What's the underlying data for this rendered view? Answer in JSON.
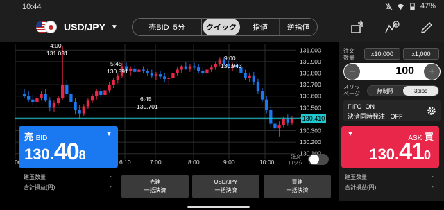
{
  "status_bar": {
    "time": "10:44",
    "battery": "47%"
  },
  "header": {
    "pair": "USD/JPY",
    "order_side": "売BID",
    "timeframe": "5分",
    "order_tabs": [
      "クイック",
      "指値",
      "逆指値"
    ],
    "active_tab": "クイック"
  },
  "chart": {
    "y_labels": [
      "131.000",
      "130.900",
      "130.800",
      "130.700",
      "130.600",
      "130.500",
      "130.400",
      "130.300",
      "130.200",
      "130.100"
    ],
    "x_labels": [
      "6:00",
      "6:10",
      "7:00",
      "8:00",
      "9:00",
      "10:00"
    ],
    "annotations": [
      {
        "time": "4:00",
        "price": "131.031"
      },
      {
        "time": "5:45",
        "price": "130.891"
      },
      {
        "time": "6:45",
        "price": "130.701"
      },
      {
        "time": "9:00",
        "price": "130.943"
      }
    ],
    "last_price": "130.410",
    "lock_label_1": "注文",
    "lock_label_2": "ロック"
  },
  "bid": {
    "side": "売",
    "label": "BID",
    "price_small": "130.",
    "price_large": "40",
    "price_tiny": "8"
  },
  "ask": {
    "side": "買",
    "label": "ASK",
    "price_small": "130.",
    "price_large": "41",
    "price_tiny": "0"
  },
  "panel": {
    "qty_label_1": "注文",
    "qty_label_2": "数量",
    "presets": [
      "x10,000",
      "x1,000"
    ],
    "quantity": "100",
    "slip_label_1": "スリッ",
    "slip_label_2": "ページ",
    "slip_options": [
      "無制限",
      "3pips"
    ],
    "fifo_label": "FIFO",
    "fifo_value": "ON",
    "simul_label": "決済同時発注",
    "simul_value": "OFF"
  },
  "bottom": {
    "left_stats": [
      {
        "label": "建玉数量",
        "value": "-"
      },
      {
        "label": "合計損益(円)",
        "value": "-"
      }
    ],
    "right_stats": [
      {
        "label": "建玉数量",
        "value": "-"
      },
      {
        "label": "合計損益(円)",
        "value": "-"
      }
    ],
    "buttons": [
      {
        "line1": "売建",
        "line2": "一括決済"
      },
      {
        "line1": "USD/JPY",
        "line2": "一括決済"
      },
      {
        "line1": "買建",
        "line2": "一括決済"
      }
    ]
  },
  "colors": {
    "up": "#e8274a",
    "down": "#1a78f0",
    "last": "#1fc7cf"
  },
  "chart_data": {
    "type": "candlestick",
    "ylim": [
      130.05,
      131.05
    ],
    "x_ticks": [
      "6:00",
      "6:10",
      "7:00",
      "8:00",
      "9:00",
      "10:00"
    ],
    "candles": [
      [
        130.62,
        130.66,
        130.58,
        130.6
      ],
      [
        130.6,
        130.64,
        130.55,
        130.57
      ],
      [
        130.57,
        130.61,
        130.52,
        130.55
      ],
      [
        130.55,
        130.6,
        130.5,
        130.58
      ],
      [
        130.58,
        130.64,
        130.56,
        130.62
      ],
      [
        130.62,
        130.66,
        130.55,
        130.56
      ],
      [
        130.56,
        130.59,
        130.47,
        130.5
      ],
      [
        130.5,
        130.56,
        130.46,
        130.54
      ],
      [
        130.54,
        130.6,
        130.52,
        130.58
      ],
      [
        130.58,
        131.03,
        130.57,
        130.7
      ],
      [
        130.7,
        130.74,
        130.6,
        130.62
      ],
      [
        130.62,
        130.65,
        130.52,
        130.55
      ],
      [
        130.55,
        130.58,
        130.44,
        130.48
      ],
      [
        130.48,
        130.52,
        130.4,
        130.45
      ],
      [
        130.45,
        130.53,
        130.43,
        130.51
      ],
      [
        130.51,
        130.58,
        130.49,
        130.56
      ],
      [
        130.56,
        130.62,
        130.54,
        130.6
      ],
      [
        130.6,
        130.66,
        130.57,
        130.64
      ],
      [
        130.64,
        130.67,
        130.59,
        130.61
      ],
      [
        130.61,
        130.66,
        130.58,
        130.65
      ],
      [
        130.65,
        130.72,
        130.63,
        130.7
      ],
      [
        130.7,
        130.76,
        130.67,
        130.74
      ],
      [
        130.74,
        130.8,
        130.71,
        130.78
      ],
      [
        130.78,
        130.89,
        130.76,
        130.86
      ],
      [
        130.86,
        130.89,
        130.8,
        130.82
      ],
      [
        130.82,
        130.86,
        130.78,
        130.84
      ],
      [
        130.84,
        130.87,
        130.8,
        130.81
      ],
      [
        130.81,
        130.85,
        130.79,
        130.83
      ],
      [
        130.83,
        130.86,
        130.8,
        130.82
      ],
      [
        130.82,
        130.84,
        130.78,
        130.8
      ],
      [
        130.8,
        130.83,
        130.76,
        130.78
      ],
      [
        130.78,
        130.81,
        130.74,
        130.79
      ],
      [
        130.79,
        130.82,
        130.75,
        130.77
      ],
      [
        130.77,
        130.8,
        130.72,
        130.75
      ],
      [
        130.75,
        130.78,
        130.7,
        130.76
      ],
      [
        130.76,
        130.82,
        130.74,
        130.8
      ],
      [
        130.8,
        130.85,
        130.78,
        130.83
      ],
      [
        130.83,
        130.87,
        130.8,
        130.86
      ],
      [
        130.86,
        130.9,
        130.83,
        130.84
      ],
      [
        130.84,
        130.88,
        130.81,
        130.86
      ],
      [
        130.86,
        130.89,
        130.83,
        130.85
      ],
      [
        130.85,
        130.88,
        130.8,
        130.82
      ],
      [
        130.82,
        130.85,
        130.78,
        130.8
      ],
      [
        130.8,
        130.84,
        130.77,
        130.83
      ],
      [
        130.83,
        130.87,
        130.81,
        130.85
      ],
      [
        130.85,
        130.9,
        130.83,
        130.88
      ],
      [
        130.88,
        130.94,
        130.86,
        130.92
      ],
      [
        130.92,
        130.94,
        130.86,
        130.88
      ],
      [
        130.88,
        130.91,
        130.84,
        130.86
      ],
      [
        130.86,
        130.89,
        130.82,
        130.87
      ],
      [
        130.87,
        130.9,
        130.83,
        130.85
      ],
      [
        130.85,
        130.87,
        130.78,
        130.8
      ],
      [
        130.8,
        130.83,
        130.74,
        130.76
      ],
      [
        130.76,
        130.8,
        130.72,
        130.78
      ],
      [
        130.78,
        130.81,
        130.7,
        130.72
      ],
      [
        130.72,
        130.75,
        130.62,
        130.64
      ],
      [
        130.64,
        130.67,
        130.55,
        130.57
      ],
      [
        130.57,
        130.6,
        130.45,
        130.48
      ],
      [
        130.48,
        130.52,
        130.33,
        130.36
      ],
      [
        130.36,
        130.4,
        130.28,
        130.32
      ],
      [
        130.32,
        130.38,
        130.25,
        130.35
      ],
      [
        130.35,
        130.42,
        130.33,
        130.4
      ],
      [
        130.4,
        130.44,
        130.34,
        130.37
      ],
      [
        130.37,
        130.43,
        130.35,
        130.41
      ]
    ]
  }
}
